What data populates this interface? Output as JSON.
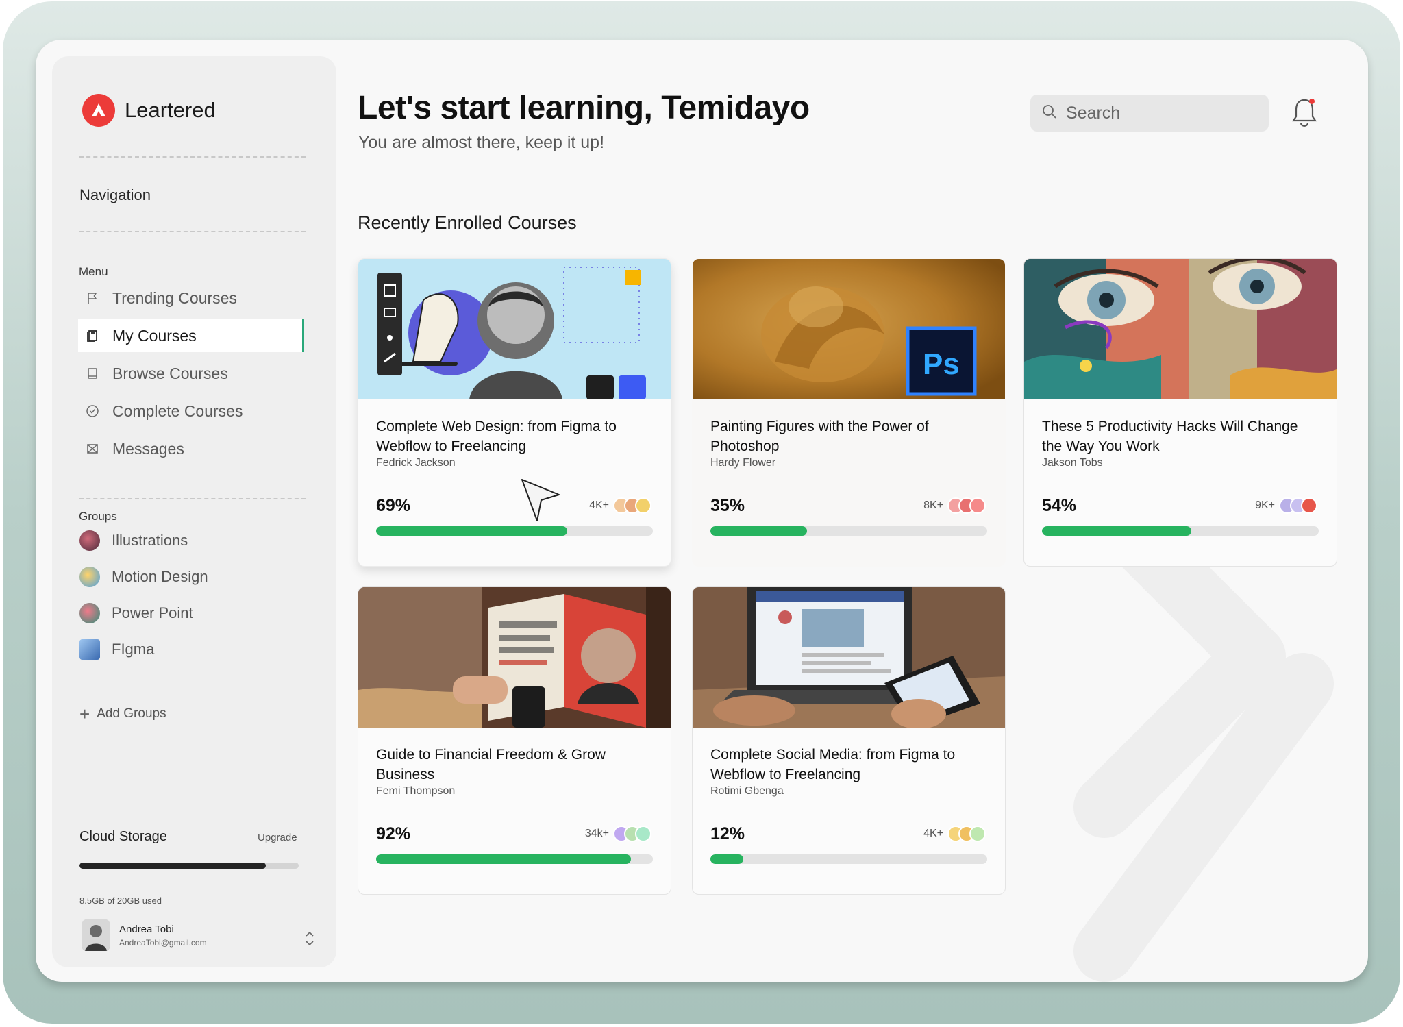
{
  "brand": {
    "name": "Leartered",
    "accent": "#ec3b39"
  },
  "sidebar": {
    "navigation_heading": "Navigation",
    "menu_label": "Menu",
    "menu": [
      {
        "label": "Trending Courses",
        "icon": "flag-icon",
        "active": false
      },
      {
        "label": "My Courses",
        "icon": "book-icon",
        "active": true
      },
      {
        "label": "Browse Courses",
        "icon": "tablet-icon",
        "active": false
      },
      {
        "label": "Complete Courses",
        "icon": "check-circle-icon",
        "active": false
      },
      {
        "label": "Messages",
        "icon": "mail-icon",
        "active": false
      }
    ],
    "groups_label": "Groups",
    "groups": [
      {
        "label": "Illustrations",
        "color": "#7a4a5a"
      },
      {
        "label": "Motion Design",
        "color": "#6aaee0"
      },
      {
        "label": "Power Point",
        "color": "#2f8f7a"
      },
      {
        "label": "FIgma",
        "color": "#4a7ab8"
      }
    ],
    "add_groups": "Add Groups",
    "storage": {
      "title": "Cloud Storage",
      "upgrade": "Upgrade",
      "used_text": "8.5GB of 20GB used",
      "used_fraction": 0.85
    },
    "user": {
      "name": "Andrea Tobi",
      "email": "AndreaTobi@gmail.com"
    }
  },
  "header": {
    "greeting": "Let's start learning, Temidayo",
    "subtitle": "You are almost there, keep it up!",
    "search_placeholder": "Search"
  },
  "main": {
    "section_title": "Recently  Enrolled Courses",
    "progress_color": "#27b35f",
    "courses": [
      {
        "title": "Complete Web Design: from Figma to Webflow to Freelancing",
        "author": "Fedrick Jackson",
        "progress": 69,
        "progress_label": "69%",
        "learners": "4K+"
      },
      {
        "title": "Painting Figures with the Power of Photoshop",
        "author": "Hardy Flower",
        "progress": 35,
        "progress_label": "35%",
        "learners": "8K+",
        "badge": "Ps"
      },
      {
        "title": "These 5 Productivity Hacks Will Change the Way You Work",
        "author": "Jakson Tobs",
        "progress": 54,
        "progress_label": "54%",
        "learners": "9K+"
      },
      {
        "title": "Guide to Financial Freedom & Grow Business",
        "author": "Femi Thompson",
        "progress": 92,
        "progress_label": "92%",
        "learners": "34k+"
      },
      {
        "title": "Complete Social Media: from Figma to Webflow to Freelancing",
        "author": "Rotimi Gbenga",
        "progress": 12,
        "progress_label": "12%",
        "learners": "4K+"
      }
    ]
  }
}
